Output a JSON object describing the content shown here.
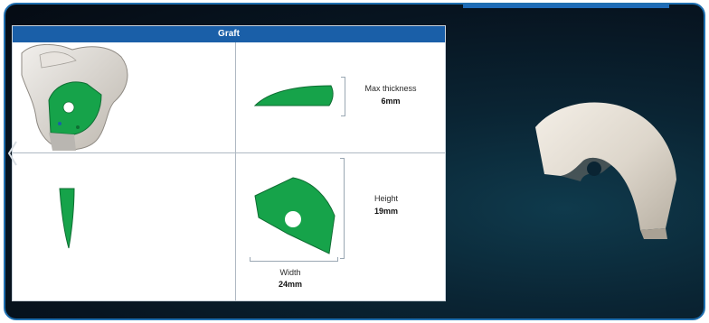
{
  "window": {
    "title": "Graft"
  },
  "measurements": {
    "max_thickness_label": "Max thickness",
    "max_thickness_value": "6mm",
    "height_label": "Height",
    "height_value": "19mm",
    "width_label": "Width",
    "width_value": "24mm"
  },
  "colors": {
    "accent_blue": "#1a5fa8",
    "graft_green": "#16a34a",
    "bone": "#d9d4cc"
  },
  "icons": {
    "prev": "chevron-left-icon"
  }
}
